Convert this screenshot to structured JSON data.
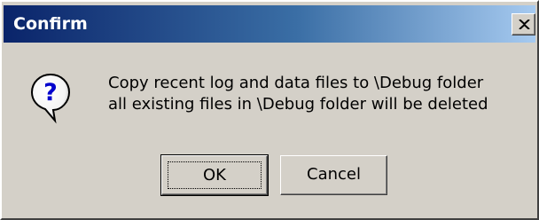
{
  "window": {
    "title": "Confirm"
  },
  "title_bar": {
    "close_icon": "close-icon",
    "gradient_start": "#0a246a",
    "gradient_end": "#a6caf0"
  },
  "message": {
    "icon": "question-icon",
    "line1": "Copy recent log and data files to \\Debug folder",
    "line2": "all existing files in \\Debug folder will be deleted"
  },
  "buttons": {
    "ok_label": "OK",
    "cancel_label": "Cancel"
  },
  "colors": {
    "dialog_face": "#d4d0c8",
    "icon_accent": "#0000cc"
  }
}
